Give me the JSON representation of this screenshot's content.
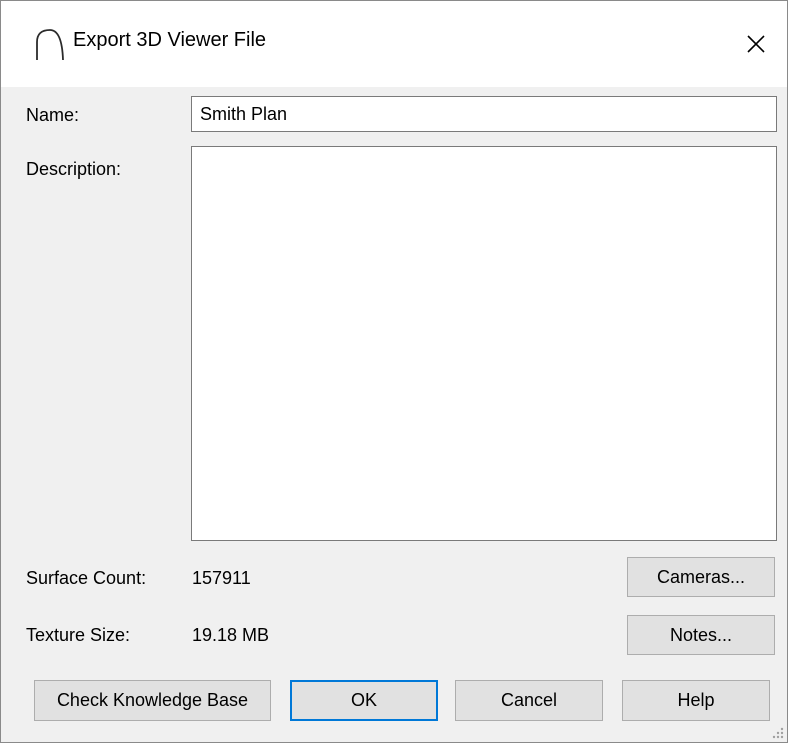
{
  "window": {
    "title": "Export 3D Viewer File",
    "icon": "arch-icon",
    "close_glyph": "✕"
  },
  "form": {
    "name_label": "Name:",
    "name_value": "Smith Plan",
    "description_label": "Description:",
    "description_value": ""
  },
  "stats": {
    "surface_count_label": "Surface Count:",
    "surface_count_value": "157911",
    "texture_size_label": "Texture Size:",
    "texture_size_value": "19.18 MB"
  },
  "buttons": {
    "cameras": "Cameras...",
    "notes": "Notes...",
    "check_kb": "Check Knowledge Base",
    "ok": "OK",
    "cancel": "Cancel",
    "help": "Help"
  },
  "colors": {
    "accent": "#0078d7",
    "dialog_bg": "#f0f0f0",
    "button_bg": "#e1e1e1"
  }
}
